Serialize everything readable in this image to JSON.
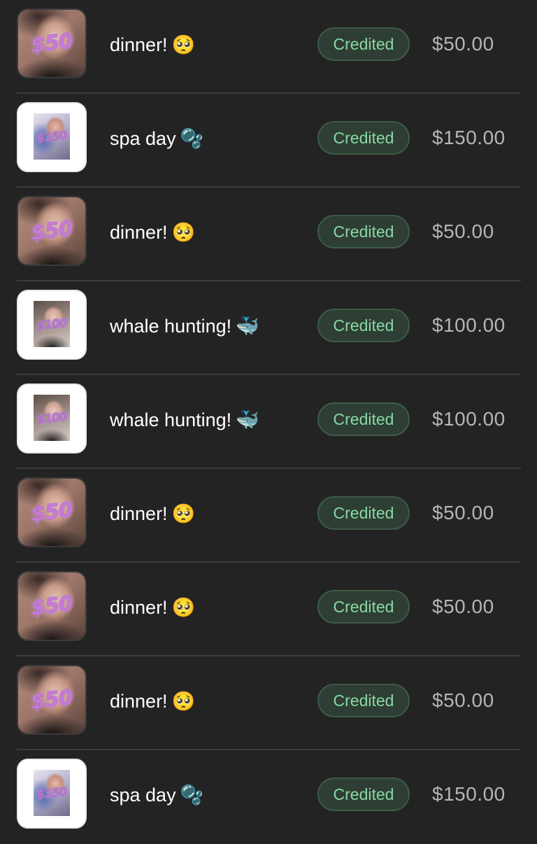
{
  "transactions": [
    {
      "title": "dinner!",
      "emoji": "🥺",
      "status": "Credited",
      "amount": "$50.00",
      "thumb_label": "$50"
    },
    {
      "title": "spa day",
      "emoji": "🫧",
      "status": "Credited",
      "amount": "$150.00",
      "thumb_label": "$150"
    },
    {
      "title": "dinner!",
      "emoji": "🥺",
      "status": "Credited",
      "amount": "$50.00",
      "thumb_label": "$50"
    },
    {
      "title": "whale hunting!",
      "emoji": "🐳",
      "status": "Credited",
      "amount": "$100.00",
      "thumb_label": "$100"
    },
    {
      "title": "whale hunting!",
      "emoji": "🐳",
      "status": "Credited",
      "amount": "$100.00",
      "thumb_label": "$100"
    },
    {
      "title": "dinner!",
      "emoji": "🥺",
      "status": "Credited",
      "amount": "$50.00",
      "thumb_label": "$50"
    },
    {
      "title": "dinner!",
      "emoji": "🥺",
      "status": "Credited",
      "amount": "$50.00",
      "thumb_label": "$50"
    },
    {
      "title": "dinner!",
      "emoji": "🥺",
      "status": "Credited",
      "amount": "$50.00",
      "thumb_label": "$50"
    },
    {
      "title": "spa day",
      "emoji": "🫧",
      "status": "Credited",
      "amount": "$150.00",
      "thumb_label": "$150"
    }
  ],
  "colors": {
    "background": "#232323",
    "divider": "#3d3d3d",
    "badge_bg": "#2e3e34",
    "badge_text": "#88d8a3",
    "amount_text": "#b6b6b6"
  }
}
